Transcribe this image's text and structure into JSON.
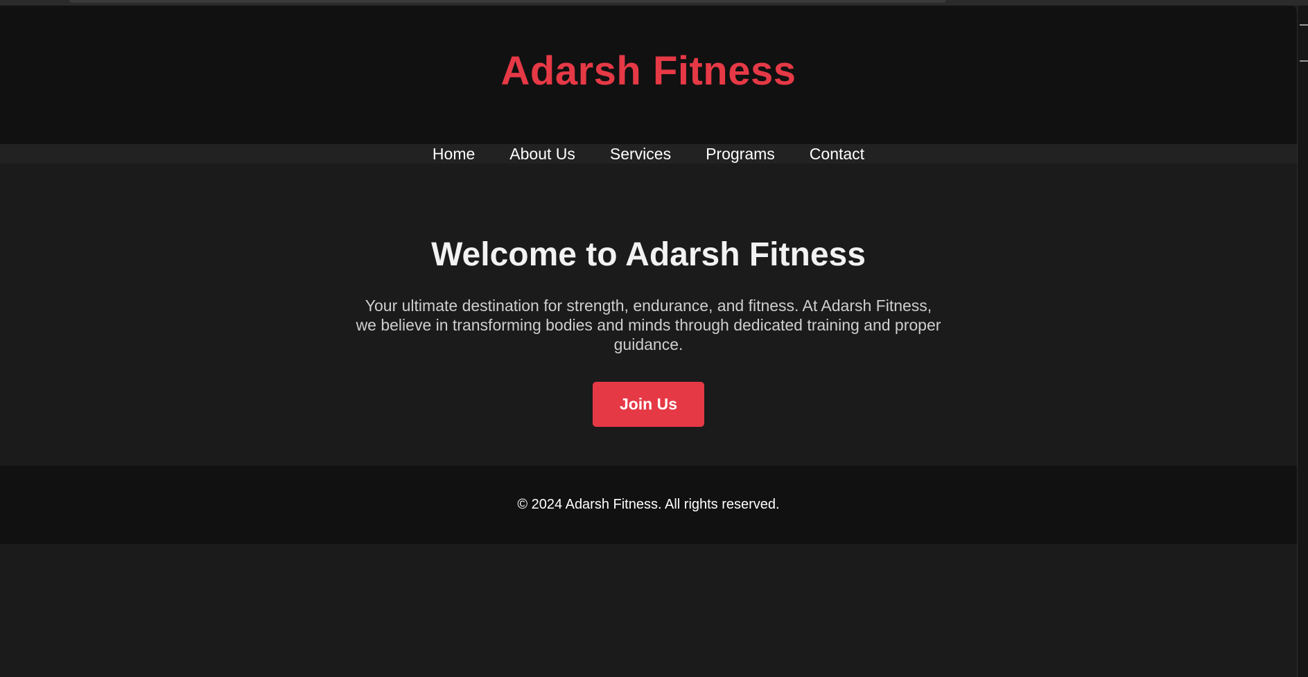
{
  "header": {
    "brand": "Adarsh Fitness"
  },
  "nav": {
    "items": [
      {
        "label": "Home"
      },
      {
        "label": "About Us"
      },
      {
        "label": "Services"
      },
      {
        "label": "Programs"
      },
      {
        "label": "Contact"
      }
    ]
  },
  "hero": {
    "title": "Welcome to Adarsh Fitness",
    "text": "Your ultimate destination for strength, endurance, and fitness. At Adarsh Fitness, we believe in transforming bodies and minds through dedicated training and proper guidance.",
    "cta_label": "Join Us"
  },
  "footer": {
    "copyright": "© 2024 Adarsh Fitness. All rights reserved."
  },
  "colors": {
    "accent": "#e63946",
    "header_bg": "#111111",
    "nav_bg": "#222222",
    "page_bg": "#1b1b1b"
  }
}
